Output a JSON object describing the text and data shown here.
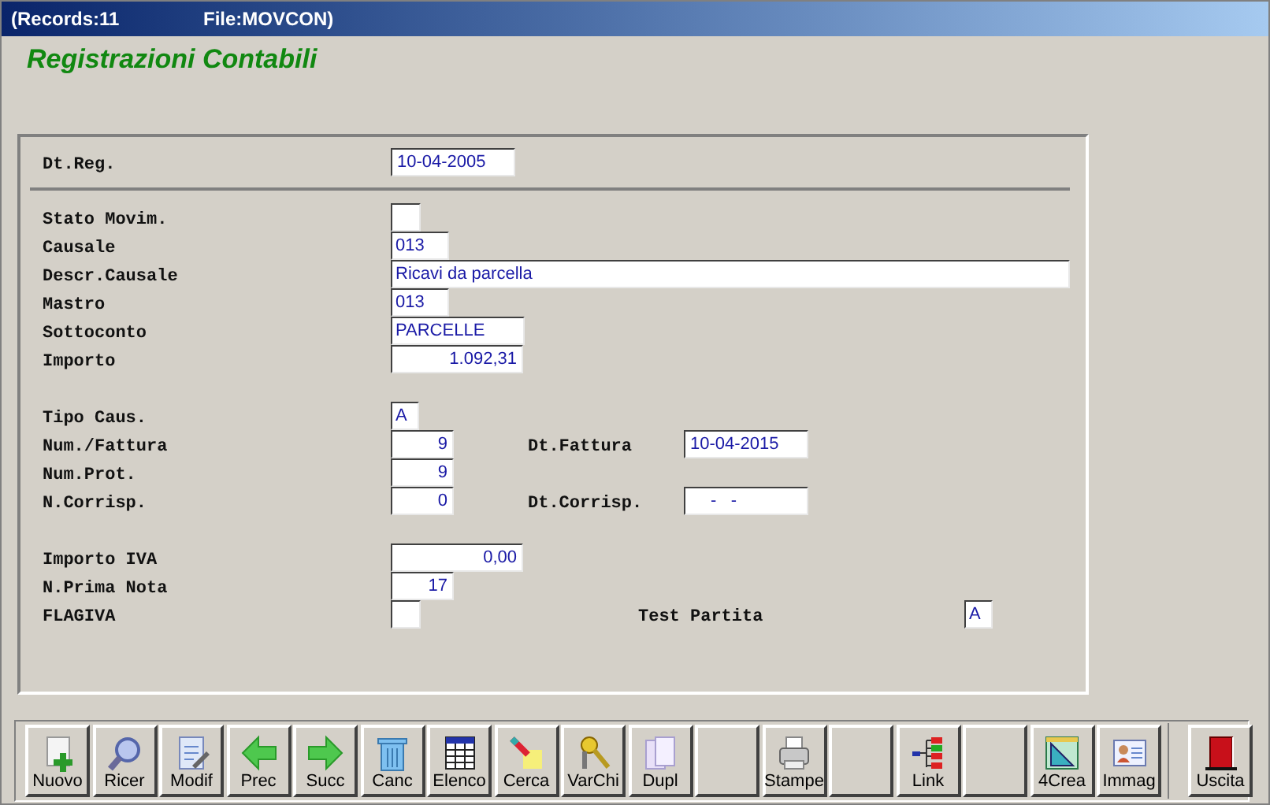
{
  "window": {
    "title_left": "(Records:11",
    "title_right": "File:MOVCON)"
  },
  "heading": "Registrazioni Contabili",
  "form": {
    "header_rows": [
      {
        "label": "Dt.Reg.",
        "field": {
          "kind": "date",
          "value": "10-04-2005"
        }
      }
    ],
    "groups": [
      [
        {
          "label": "Stato Movim.",
          "field": {
            "kind": "flag"
          }
        },
        {
          "label": "Causale",
          "field": {
            "kind": "code",
            "value": "013"
          }
        },
        {
          "label": "Descr.Causale",
          "field": {
            "kind": "long",
            "value": "Ricavi da parcella"
          }
        },
        {
          "label": "Mastro",
          "field": {
            "kind": "code",
            "value": "013"
          }
        },
        {
          "label": "Sottoconto",
          "field": {
            "kind": "name",
            "value": "PARCELLE"
          }
        },
        {
          "label": "Importo",
          "field": {
            "kind": "amount",
            "value": "1.092,31"
          }
        }
      ],
      [
        {
          "label": "Tipo Caus.",
          "field": {
            "kind": "char",
            "value": "A"
          }
        },
        {
          "label": "Num./Fattura",
          "field": {
            "kind": "number",
            "value": "9"
          },
          "second": {
            "label": "Dt.Fattura",
            "field": {
              "kind": "date",
              "value": "10-04-2015"
            }
          }
        },
        {
          "label": "Num.Prot.",
          "field": {
            "kind": "number",
            "value": "9"
          }
        },
        {
          "label": "N.Corrisp.",
          "field": {
            "kind": "number",
            "value": "0"
          },
          "second": {
            "label": "Dt.Corrisp.",
            "field": {
              "kind": "emptydate",
              "value": "-   -"
            }
          }
        }
      ],
      [
        {
          "label": "Importo IVA",
          "field": {
            "kind": "amount",
            "value": "0,00"
          }
        },
        {
          "label": "N.Prima Nota",
          "field": {
            "kind": "number",
            "value": "17"
          }
        },
        {
          "label": "FLAGIVA",
          "field": {
            "kind": "flag"
          },
          "second": {
            "label": "Test Partita",
            "field": {
              "kind": "char",
              "value": "A"
            }
          }
        }
      ]
    ]
  },
  "toolbar": [
    {
      "kind": "button",
      "label": "Nuovo"
    },
    {
      "kind": "button",
      "label": "Ricer"
    },
    {
      "kind": "button",
      "label": "Modif"
    },
    {
      "kind": "button",
      "label": "Prec"
    },
    {
      "kind": "button",
      "label": "Succ"
    },
    {
      "kind": "button",
      "label": "Canc"
    },
    {
      "kind": "button",
      "label": "Elenco"
    },
    {
      "kind": "button",
      "label": "Cerca"
    },
    {
      "kind": "button",
      "label": "VarChi"
    },
    {
      "kind": "button",
      "label": "Dupl"
    },
    {
      "kind": "blank"
    },
    {
      "kind": "button",
      "label": "Stampe"
    },
    {
      "kind": "blank"
    },
    {
      "kind": "button",
      "label": "Link"
    },
    {
      "kind": "blank"
    },
    {
      "kind": "button",
      "label": "4Crea"
    },
    {
      "kind": "button",
      "label": "Immag"
    },
    {
      "kind": "exit",
      "label": "Uscita"
    }
  ]
}
